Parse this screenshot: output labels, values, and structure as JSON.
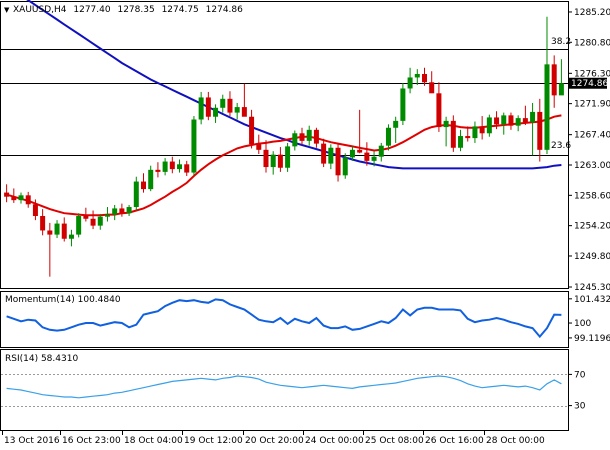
{
  "colors": {
    "bull": "#008a00",
    "bear": "#d10000",
    "sma_fast": "#e00000",
    "sma_slow": "#1010c0",
    "indicator": "#1060e0",
    "rsi": "#3aa0e8",
    "price_tag_bg": "#000000",
    "price_tag_fg": "#ffffff"
  },
  "chart_data": [
    {
      "type": "candlestick",
      "title": "XAUUSD,H4 1277.40 1278.35 1274.75 1274.86",
      "symbol": "XAUUSD,H4",
      "ohlc_header": [
        "1277.40",
        "1278.35",
        "1274.75",
        "1274.86"
      ],
      "ylim": [
        1245.3,
        1286.5
      ],
      "y_ticks": [
        "1285.20",
        "1280.80",
        "1276.30",
        "1271.90",
        "1267.40",
        "1263.00",
        "1258.60",
        "1254.20",
        "1249.80",
        "1245.30"
      ],
      "current_price": "1274.86",
      "levels": [
        {
          "name": "38.2",
          "value": 1279.8
        },
        {
          "name": "",
          "value": 1274.86
        },
        {
          "name": "23.6",
          "value": 1264.4
        }
      ],
      "x_labels": [
        "13 Oct 2016",
        "16 Oct 23:00",
        "18 Oct 04:00",
        "19 Oct 12:00",
        "20 Oct 20:00",
        "24 Oct 00:00",
        "25 Oct 08:00",
        "26 Oct 16:00",
        "28 Oct 00:00"
      ],
      "candles": [
        [
          1259.0,
          1260.2,
          1257.6,
          1258.4
        ],
        [
          1258.4,
          1259.6,
          1257.5,
          1257.9
        ],
        [
          1257.9,
          1259.0,
          1257.4,
          1258.6
        ],
        [
          1258.6,
          1259.1,
          1256.8,
          1257.3
        ],
        [
          1257.3,
          1258.0,
          1255.0,
          1255.6
        ],
        [
          1255.6,
          1256.6,
          1252.8,
          1253.5
        ],
        [
          1253.5,
          1254.6,
          1246.8,
          1252.9
        ],
        [
          1252.9,
          1255.0,
          1252.4,
          1254.5
        ],
        [
          1254.5,
          1255.4,
          1251.9,
          1252.3
        ],
        [
          1252.3,
          1253.6,
          1251.2,
          1252.9
        ],
        [
          1252.9,
          1256.0,
          1252.5,
          1255.6
        ],
        [
          1255.6,
          1256.8,
          1254.8,
          1255.2
        ],
        [
          1255.2,
          1256.4,
          1253.7,
          1254.2
        ],
        [
          1254.2,
          1255.9,
          1253.6,
          1255.5
        ],
        [
          1255.5,
          1256.9,
          1254.8,
          1255.8
        ],
        [
          1255.8,
          1257.2,
          1255.0,
          1256.7
        ],
        [
          1256.7,
          1257.4,
          1255.5,
          1256.0
        ],
        [
          1256.0,
          1257.2,
          1255.6,
          1256.9
        ],
        [
          1256.9,
          1261.3,
          1256.4,
          1260.6
        ],
        [
          1260.6,
          1261.8,
          1259.0,
          1259.5
        ],
        [
          1259.5,
          1262.9,
          1259.2,
          1262.3
        ],
        [
          1262.3,
          1263.4,
          1261.2,
          1262.0
        ],
        [
          1262.0,
          1264.0,
          1261.5,
          1263.5
        ],
        [
          1263.5,
          1264.2,
          1261.8,
          1262.4
        ],
        [
          1262.4,
          1263.8,
          1261.9,
          1263.1
        ],
        [
          1263.1,
          1263.6,
          1261.4,
          1261.9
        ],
        [
          1261.9,
          1270.1,
          1261.5,
          1269.6
        ],
        [
          1269.6,
          1273.6,
          1268.9,
          1272.8
        ],
        [
          1272.8,
          1273.6,
          1269.5,
          1270.0
        ],
        [
          1270.0,
          1271.8,
          1269.1,
          1271.3
        ],
        [
          1271.3,
          1273.2,
          1270.6,
          1272.6
        ],
        [
          1272.6,
          1273.7,
          1270.1,
          1270.6
        ],
        [
          1270.6,
          1272.0,
          1269.6,
          1271.4
        ],
        [
          1271.4,
          1274.8,
          1270.9,
          1270.0
        ],
        [
          1270.0,
          1271.0,
          1265.4,
          1266.0
        ],
        [
          1266.0,
          1267.4,
          1264.6,
          1265.2
        ],
        [
          1265.2,
          1266.6,
          1261.9,
          1262.7
        ],
        [
          1262.7,
          1265.0,
          1261.6,
          1264.5
        ],
        [
          1264.5,
          1265.6,
          1262.0,
          1262.6
        ],
        [
          1262.6,
          1266.2,
          1262.0,
          1265.7
        ],
        [
          1265.7,
          1268.0,
          1265.1,
          1267.6
        ],
        [
          1267.6,
          1268.4,
          1265.9,
          1266.5
        ],
        [
          1266.5,
          1268.7,
          1265.8,
          1268.1
        ],
        [
          1268.1,
          1268.4,
          1265.5,
          1266.1
        ],
        [
          1266.1,
          1266.8,
          1262.7,
          1263.2
        ],
        [
          1263.2,
          1266.0,
          1262.4,
          1265.5
        ],
        [
          1265.5,
          1266.2,
          1260.6,
          1261.5
        ],
        [
          1261.5,
          1264.7,
          1261.0,
          1264.1
        ],
        [
          1264.1,
          1265.7,
          1263.6,
          1265.2
        ],
        [
          1265.2,
          1271.0,
          1264.7,
          1264.8
        ],
        [
          1264.8,
          1266.3,
          1262.9,
          1263.6
        ],
        [
          1263.6,
          1265.0,
          1262.8,
          1264.2
        ],
        [
          1264.2,
          1266.2,
          1263.5,
          1265.8
        ],
        [
          1265.8,
          1268.9,
          1265.1,
          1268.4
        ],
        [
          1268.4,
          1270.0,
          1266.2,
          1269.4
        ],
        [
          1269.4,
          1274.9,
          1268.8,
          1274.1
        ],
        [
          1274.1,
          1277.1,
          1273.4,
          1275.7
        ],
        [
          1275.7,
          1276.9,
          1274.6,
          1276.2
        ],
        [
          1276.2,
          1277.1,
          1274.5,
          1275.0
        ],
        [
          1275.0,
          1276.6,
          1273.9,
          1273.4
        ],
        [
          1273.4,
          1275.0,
          1267.8,
          1268.5
        ],
        [
          1268.5,
          1270.0,
          1265.7,
          1269.4
        ],
        [
          1269.4,
          1270.2,
          1264.9,
          1265.5
        ],
        [
          1265.5,
          1268.1,
          1265.0,
          1267.2
        ],
        [
          1267.2,
          1268.6,
          1266.4,
          1266.9
        ],
        [
          1266.9,
          1269.3,
          1266.2,
          1268.6
        ],
        [
          1268.6,
          1270.1,
          1266.7,
          1267.6
        ],
        [
          1267.6,
          1270.3,
          1267.1,
          1269.9
        ],
        [
          1269.9,
          1270.8,
          1268.2,
          1268.9
        ],
        [
          1268.9,
          1270.6,
          1267.4,
          1270.2
        ],
        [
          1270.2,
          1270.6,
          1268.1,
          1268.7
        ],
        [
          1268.7,
          1270.2,
          1267.9,
          1269.8
        ],
        [
          1269.8,
          1271.6,
          1268.8,
          1269.2
        ],
        [
          1269.2,
          1272.0,
          1264.4,
          1270.7
        ],
        [
          1270.7,
          1272.6,
          1263.5,
          1265.2
        ],
        [
          1265.2,
          1284.5,
          1264.6,
          1277.6
        ],
        [
          1277.6,
          1278.9,
          1271.3,
          1273.1
        ],
        [
          1273.1,
          1278.35,
          1274.75,
          1274.86
        ]
      ],
      "sma_fast": [
        1258.7,
        1258.4,
        1258.1,
        1257.8,
        1257.4,
        1257.0,
        1256.6,
        1256.3,
        1256.0,
        1255.9,
        1255.8,
        1255.7,
        1255.7,
        1255.7,
        1255.8,
        1255.8,
        1256.0,
        1256.1,
        1256.4,
        1256.7,
        1257.2,
        1257.8,
        1258.4,
        1259.1,
        1259.7,
        1260.4,
        1261.4,
        1262.3,
        1263.1,
        1263.8,
        1264.4,
        1264.9,
        1265.4,
        1265.7,
        1265.9,
        1266.1,
        1266.2,
        1266.4,
        1266.5,
        1266.7,
        1266.9,
        1267.1,
        1267.1,
        1266.9,
        1266.6,
        1266.3,
        1266.1,
        1265.9,
        1265.7,
        1265.5,
        1265.3,
        1265.1,
        1265.2,
        1265.4,
        1265.8,
        1266.3,
        1266.9,
        1267.5,
        1268.1,
        1268.5,
        1268.7,
        1268.8,
        1268.7,
        1268.5,
        1268.4,
        1268.4,
        1268.5,
        1268.6,
        1268.7,
        1268.8,
        1268.9,
        1269.0,
        1269.1,
        1269.2,
        1269.3,
        1269.6,
        1270.0,
        1270.2
      ],
      "sma_slow": [
        1289.0,
        1288.3,
        1287.6,
        1286.9,
        1286.2,
        1285.5,
        1284.8,
        1284.1,
        1283.4,
        1282.7,
        1282.0,
        1281.3,
        1280.6,
        1279.9,
        1279.2,
        1278.5,
        1277.8,
        1277.2,
        1276.6,
        1276.0,
        1275.4,
        1274.9,
        1274.4,
        1273.9,
        1273.4,
        1272.9,
        1272.4,
        1271.9,
        1271.4,
        1270.9,
        1270.4,
        1269.9,
        1269.4,
        1268.9,
        1268.5,
        1268.1,
        1267.7,
        1267.3,
        1266.9,
        1266.6,
        1266.2,
        1265.9,
        1265.6,
        1265.3,
        1265.0,
        1264.7,
        1264.4,
        1264.1,
        1263.8,
        1263.5,
        1263.3,
        1263.1,
        1262.9,
        1262.7,
        1262.6,
        1262.5,
        1262.5,
        1262.5,
        1262.5,
        1262.5,
        1262.5,
        1262.5,
        1262.5,
        1262.5,
        1262.5,
        1262.5,
        1262.5,
        1262.5,
        1262.5,
        1262.5,
        1262.5,
        1262.5,
        1262.5,
        1262.5,
        1262.6,
        1262.7,
        1262.9,
        1263.0
      ]
    },
    {
      "type": "line",
      "title": "Momentum(14) 100.4840",
      "name": "Momentum(14)",
      "current_value": "100.4840",
      "ylim": [
        98.7,
        101.6
      ],
      "y_ticks": [
        "101.4329",
        "100",
        "99.1196"
      ],
      "values": [
        100.4,
        100.25,
        100.1,
        100.2,
        100.15,
        99.75,
        99.6,
        99.55,
        99.6,
        99.75,
        99.9,
        100.0,
        100.0,
        99.85,
        99.95,
        100.05,
        100.0,
        99.75,
        99.9,
        100.5,
        100.6,
        100.7,
        101.0,
        101.2,
        101.35,
        101.3,
        101.35,
        101.25,
        101.2,
        101.4,
        101.35,
        101.1,
        100.95,
        100.8,
        100.5,
        100.2,
        100.1,
        100.05,
        100.3,
        99.95,
        100.25,
        100.1,
        100.0,
        100.3,
        99.85,
        99.7,
        99.7,
        99.8,
        99.6,
        99.65,
        99.8,
        99.95,
        100.1,
        100.0,
        100.3,
        100.8,
        100.45,
        100.8,
        100.9,
        100.9,
        100.8,
        100.8,
        100.8,
        100.75,
        100.25,
        100.05,
        100.15,
        100.2,
        100.3,
        100.2,
        100.05,
        99.95,
        99.8,
        99.7,
        99.2,
        99.7,
        100.5,
        100.48
      ]
    },
    {
      "type": "line",
      "title": "RSI(14) 58.4310",
      "name": "RSI(14)",
      "current_value": "58.4310",
      "ylim": [
        0,
        100
      ],
      "y_ticks": [
        "70",
        "30"
      ],
      "levels": [
        70,
        30
      ],
      "values": [
        52,
        51,
        50,
        48,
        46,
        44,
        43,
        42,
        41,
        41,
        40,
        41,
        42,
        43,
        44,
        46,
        47,
        49,
        51,
        53,
        55,
        57,
        59,
        61,
        62,
        63,
        64,
        65,
        64,
        63,
        65,
        66,
        68,
        67,
        66,
        64,
        60,
        58,
        56,
        55,
        54,
        53,
        54,
        55,
        56,
        55,
        54,
        53,
        52,
        54,
        55,
        56,
        57,
        58,
        59,
        61,
        63,
        65,
        66,
        67,
        68,
        67,
        65,
        62,
        58,
        55,
        53,
        54,
        55,
        56,
        55,
        54,
        55,
        53,
        50,
        58,
        63,
        58
      ]
    }
  ]
}
